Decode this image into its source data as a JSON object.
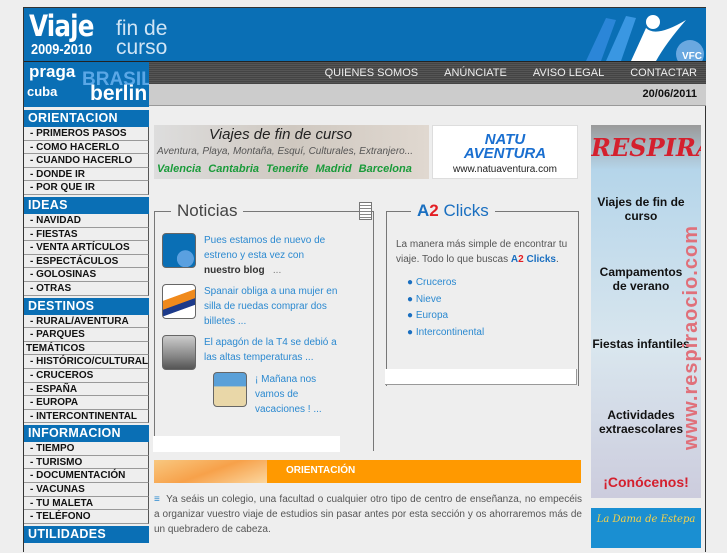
{
  "header": {
    "logo_main": "Viaje",
    "logo_years": "2009-2010",
    "logo_sub1": "fin de",
    "logo_sub2": "curso",
    "brand_badge": "VFC"
  },
  "destinations_logo": [
    "praga",
    "BRASIL",
    "cuba",
    "berlin"
  ],
  "nav": [
    "QUIENES SOMOS",
    "ANÚNCIATE",
    "AVISO LEGAL",
    "CONTACTAR"
  ],
  "date": "20/06/2011",
  "sidebar": [
    {
      "title": "ORIENTACION",
      "items": [
        "-  PRIMEROS PASOS",
        "-  COMO HACERLO",
        "-  CUANDO HACERLO",
        "-  DONDE IR",
        "-  POR QUE IR"
      ]
    },
    {
      "title": "IDEAS",
      "items": [
        "-  NAVIDAD",
        "-  FIESTAS",
        "-  VENTA ARTÍCULOS",
        "-  ESPECTÁCULOS",
        "-  GOLOSINAS",
        "-  OTRAS"
      ]
    },
    {
      "title": "DESTINOS",
      "items": [
        "-  RURAL/AVENTURA",
        "-  PARQUES",
        "TEMÁTICOS",
        "-  HISTÓRICO/CULTURAL",
        "-  CRUCEROS",
        "-  ESPAÑA",
        "-  EUROPA",
        "-  INTERCONTINENTAL"
      ]
    },
    {
      "title": "INFORMACION",
      "items": [
        "-  TIEMPO",
        "-  TURISMO",
        "-  DOCUMENTACIÓN",
        "-  VACUNAS",
        "-  TU MALETA",
        "-  TELÉFONO"
      ]
    },
    {
      "title": "UTILIDADES",
      "items": []
    }
  ],
  "banner": {
    "title": "Viajes de fin de curso",
    "subtitle": "Aventura, Playa, Montaña, Esquí, Culturales, Extranjero...",
    "cities": "Valencia  Cantabria  Tenerife  Madrid  Barcelona"
  },
  "natu": {
    "name1": "NATU",
    "name2": "AVENTURA",
    "url": "www.natuaventura.com"
  },
  "noticias": {
    "title": "Noticias",
    "items": [
      {
        "text": "Pues estamos de nuevo de estreno y esta vez con",
        "bold": "nuestro blog",
        "more": "..."
      },
      {
        "text": "Spanair obliga a una mujer en silla de ruedas comprar dos billetes ..."
      },
      {
        "text": "El apagón de la T4 se debió a las altas temperaturas ..."
      },
      {
        "text": "¡ Mañana nos vamos de vacaciones ! ..."
      }
    ]
  },
  "a2": {
    "title_a": "A",
    "title_2": "2",
    "title_rest": " Clicks",
    "desc": "La manera más simple de encontrar tu viaje. Todo lo que buscas ",
    "desc_a": "A",
    "desc_2": "2",
    "desc_clicks": " Clicks",
    "desc_end": ".",
    "links": [
      "Cruceros",
      "Nieve",
      "Europa",
      "Intercontinental"
    ]
  },
  "orientacion": {
    "title": "ORIENTACIÓN",
    "bullet": "≡",
    "text": "Ya seáis un colegio, una facultad o cualquier otro tipo de centro de enseñanza, no empecéis a organizar vuestro viaje de estudios sin pasar antes por esta sección y os ahorraremos más de un quebradero de cabeza."
  },
  "respira": {
    "logo": "RESPIRA",
    "lines": [
      "Viajes de fin de curso",
      "Campamentos de verano",
      "Fiestas infantiles",
      "Actividades extraescolares"
    ],
    "url": "www.respiraocio.com",
    "cta": "¡Conócenos!"
  },
  "dama": {
    "text": "La Dama de Estepa"
  },
  "colors": {
    "blue": "#0a6fb5",
    "orange": "#ff9900",
    "link": "#2b89d0",
    "red": "#e31e24"
  }
}
